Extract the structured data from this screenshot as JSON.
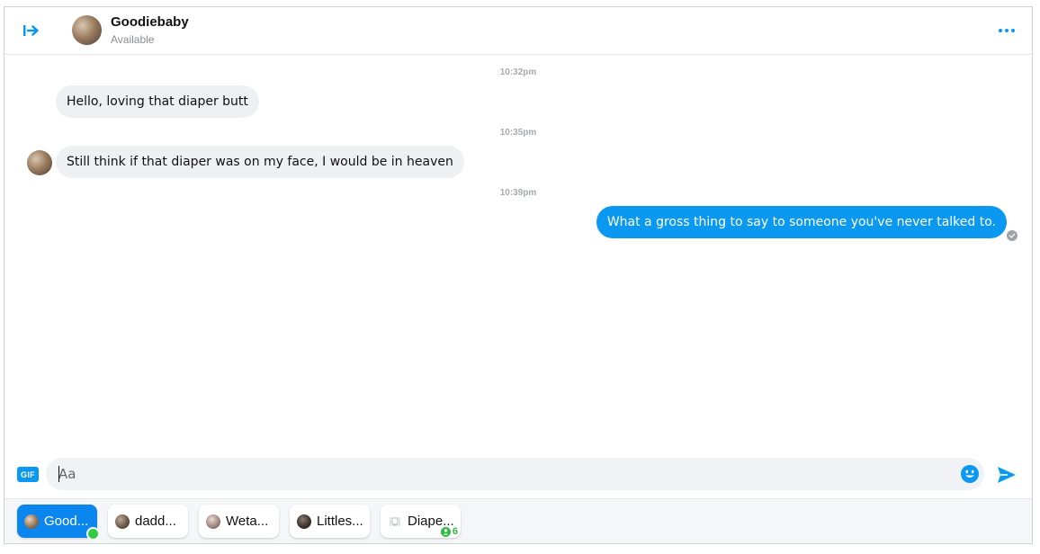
{
  "header": {
    "contact_name": "Goodiebaby",
    "status": "Available"
  },
  "messages": [
    {
      "timestamp": "10:32pm",
      "direction": "in",
      "text": "Hello, loving that diaper butt",
      "show_avatar": false
    },
    {
      "timestamp": "10:35pm",
      "direction": "in",
      "text": "Still think if that diaper was on my face, I would be in heaven",
      "show_avatar": true
    },
    {
      "timestamp": "10:39pm",
      "direction": "out",
      "text": "What a gross thing to say to someone you've never talked to.",
      "seen": true
    }
  ],
  "composer": {
    "gif_label": "GIF",
    "placeholder": "Aa"
  },
  "chat_tabs": [
    {
      "label": "Good...",
      "active": true,
      "online": true
    },
    {
      "label": "dadd...",
      "active": false
    },
    {
      "label": "Weta...",
      "active": false
    },
    {
      "label": "Littles...",
      "active": false
    },
    {
      "label": "Diape...",
      "active": false,
      "group_members": "6"
    }
  ],
  "colors": {
    "accent": "#0a98f0",
    "outgoing_bubble": "#0a98f0",
    "incoming_bubble": "#eff0f2",
    "online": "#31cc46"
  }
}
